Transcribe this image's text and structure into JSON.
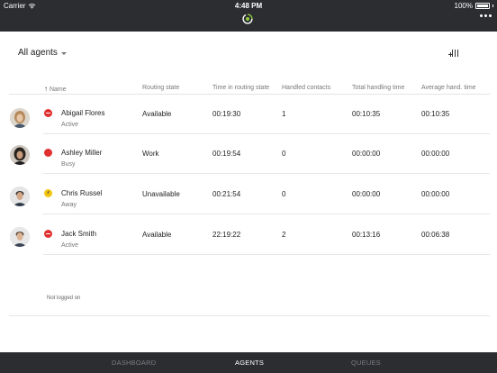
{
  "status_bar": {
    "carrier": "Carrier",
    "time": "4:48 PM",
    "battery": "100%"
  },
  "toolbar": {
    "filter_label": "All agents"
  },
  "columns": {
    "name": "Name",
    "routing_state": "Routing state",
    "time_in_state": "Time in routing state",
    "handled": "Handled contacts",
    "total_time": "Total handling time",
    "avg_time": "Average hand. time"
  },
  "agents": [
    {
      "name": "Abigail Flores",
      "status": "Active",
      "routing": "Available",
      "time_in_state": "00:19:30",
      "handled": "1",
      "total": "00:10:35",
      "avg": "00:10:35"
    },
    {
      "name": "Ashley Miller",
      "status": "Busy",
      "routing": "Work",
      "time_in_state": "00:19:54",
      "handled": "0",
      "total": "00:00:00",
      "avg": "00:00:00"
    },
    {
      "name": "Chris Russel",
      "status": "Away",
      "routing": "Unavailable",
      "time_in_state": "00:21:54",
      "handled": "0",
      "total": "00:00:00",
      "avg": "00:00:00"
    },
    {
      "name": "Jack Smith",
      "status": "Active",
      "routing": "Available",
      "time_in_state": "22:19:22",
      "handled": "2",
      "total": "00:13:16",
      "avg": "00:06:38"
    }
  ],
  "not_logged_on": "Not logged on",
  "tabs": {
    "dashboard": "DASHBOARD",
    "agents": "AGENTS",
    "queues": "QUEUES"
  },
  "colors": {
    "bar_bg": "#2b2d30",
    "status_red": "#e03130",
    "status_yellow": "#f1c40f",
    "logo_green": "#8cc63f"
  }
}
